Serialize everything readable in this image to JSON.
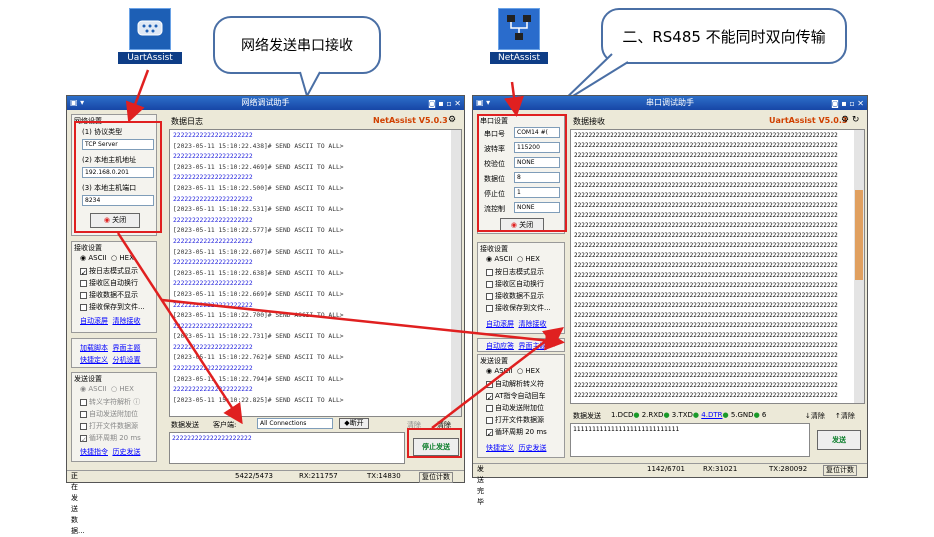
{
  "desktop": {
    "left_icon_label": "UartAssist",
    "right_icon_label": "NetAssist"
  },
  "callouts": {
    "left": "网络发送串口接收",
    "right": "二、RS485 不能同时双向传输"
  },
  "net": {
    "title": "网络调试助手",
    "version": "NetAssist V5.0.3",
    "settings_title": "网络设置",
    "protocol_label": "(1) 协议类型",
    "protocol_value": "TCP Server",
    "host_label": "(2) 本地主机地址",
    "host_value": "192.168.0.201",
    "port_label": "(3) 本地主机端口",
    "port_value": "8234",
    "close_btn": "关闭",
    "recv_title": "接收设置",
    "recv_ascii": "ASCII",
    "recv_hex": "HEX",
    "recv_opts": [
      "按日志模式显示",
      "接收区自动换行",
      "接收数据不显示",
      "接收保存到文件..."
    ],
    "auto_scroll": "自动滚屏",
    "clear_recv": "清除接收",
    "script_a": "加载脚本",
    "script_b": "界面主题",
    "script_c": "快捷定义",
    "script_d": "分机设置",
    "send_title": "发送设置",
    "send_ascii": "ASCII",
    "send_hex": "HEX",
    "send_opts": [
      "转义字符解析 ⓘ",
      "自动发送附加位",
      "打开文件数据源",
      "循环周期 20 ms"
    ],
    "shortcut": "快捷指令",
    "history": "历史发送",
    "log_tab": "数据日志",
    "log_lines": [
      {
        "kind": "data",
        "text": "222222222222222222222"
      },
      {
        "kind": "hdr",
        "text": "[2023-05-11 15:10:22.438]# SEND ASCII TO ALL>"
      },
      {
        "kind": "data",
        "text": "222222222222222222222"
      },
      {
        "kind": "hdr",
        "text": "[2023-05-11 15:10:22.469]# SEND ASCII TO ALL>"
      },
      {
        "kind": "data",
        "text": "222222222222222222222"
      },
      {
        "kind": "hdr",
        "text": "[2023-05-11 15:10:22.500]# SEND ASCII TO ALL>"
      },
      {
        "kind": "data",
        "text": "222222222222222222222"
      },
      {
        "kind": "hdr",
        "text": "[2023-05-11 15:10:22.531]# SEND ASCII TO ALL>"
      },
      {
        "kind": "data",
        "text": "222222222222222222222"
      },
      {
        "kind": "hdr",
        "text": "[2023-05-11 15:10:22.577]# SEND ASCII TO ALL>"
      },
      {
        "kind": "data",
        "text": "222222222222222222222"
      },
      {
        "kind": "hdr",
        "text": "[2023-05-11 15:10:22.607]# SEND ASCII TO ALL>"
      },
      {
        "kind": "data",
        "text": "222222222222222222222"
      },
      {
        "kind": "hdr",
        "text": "[2023-05-11 15:10:22.638]# SEND ASCII TO ALL>"
      },
      {
        "kind": "data",
        "text": "222222222222222222222"
      },
      {
        "kind": "hdr",
        "text": "[2023-05-11 15:10:22.669]# SEND ASCII TO ALL>"
      },
      {
        "kind": "data",
        "text": "222222222222222222222"
      },
      {
        "kind": "hdr",
        "text": "[2023-05-11 15:10:22.700]# SEND ASCII TO ALL>"
      },
      {
        "kind": "data",
        "text": "222222222222222222222"
      },
      {
        "kind": "hdr",
        "text": "[2023-05-11 15:10:22.731]# SEND ASCII TO ALL>"
      },
      {
        "kind": "data",
        "text": "222222222222222222222"
      },
      {
        "kind": "hdr",
        "text": "[2023-05-11 15:10:22.762]# SEND ASCII TO ALL>"
      },
      {
        "kind": "data",
        "text": "222222222222222222222"
      },
      {
        "kind": "hdr",
        "text": "[2023-05-11 15:10:22.794]# SEND ASCII TO ALL>"
      },
      {
        "kind": "data",
        "text": "222222222222222222222"
      },
      {
        "kind": "hdr",
        "text": "[2023-05-11 15:10:22.825]# SEND ASCII TO ALL>"
      }
    ],
    "send_tab": "数据发送",
    "client_label": "客户端:",
    "client_value": "All Connections",
    "disconnect": "断开",
    "clear_a": "清除",
    "clear_b": "清除",
    "send_text": "222222222222222222222",
    "stop_send": "停止发送",
    "status_msg": "正在发送数据...",
    "status_count": "5422/5473",
    "status_rx": "RX:211757",
    "status_tx": "TX:14830",
    "reset_count": "复位计数"
  },
  "uart": {
    "title": "串口调试助手",
    "version": "UartAssist V5.0.3",
    "settings_title": "串口设置",
    "port_label": "串口号",
    "port_value": "COM14 #(",
    "baud_label": "波特率",
    "baud_value": "115200",
    "parity_label": "校验位",
    "parity_value": "NONE",
    "data_label": "数据位",
    "data_value": "8",
    "stop_label": "停止位",
    "stop_value": "1",
    "flow_label": "流控制",
    "flow_value": "NONE",
    "close_btn": "关闭",
    "recv_title": "接收设置",
    "recv_ascii": "ASCII",
    "recv_hex": "HEX",
    "recv_opts": [
      "按日志模式显示",
      "接收区自动换行",
      "接收数据不显示",
      "接收保存到文件..."
    ],
    "auto_scroll": "自动滚屏",
    "clear_recv": "清除接收",
    "script_a": "自动应答",
    "script_b": "界面主题",
    "send_title": "发送设置",
    "send_ascii": "ASCII",
    "send_hex": "HEX",
    "send_opts": [
      "自动解析转义符",
      "AT指令自动回车",
      "自动发送附加位",
      "打开文件数据源",
      "循环周期 20 ms"
    ],
    "shortcut": "快捷定义",
    "history": "历史发送",
    "recv_tab": "数据接收",
    "recv_line": "2222222222222222222222222222222222222222222222222222222222222222222222222",
    "recv_line_count": 27,
    "send_tab": "数据发送",
    "pins": [
      "1.DCD",
      "2.RXD",
      "3.TXD",
      "4.DTR",
      "5.GND",
      "6"
    ],
    "clear_a": "清除",
    "clear_b": "清除",
    "send_text": "1111111111111111111111111111",
    "send_btn": "发送",
    "status_msg": "发送完毕",
    "status_count": "1142/6701",
    "status_rx": "RX:31021",
    "status_tx": "TX:280092",
    "reset_count": "复位计数"
  }
}
